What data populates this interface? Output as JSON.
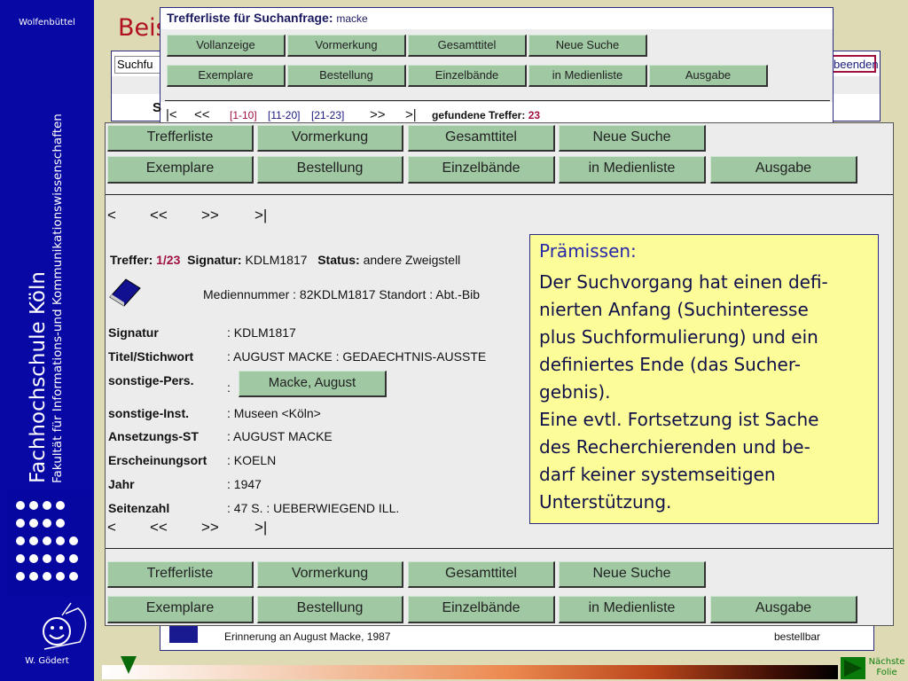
{
  "sidebar": {
    "top_label": "Wolfenbüttel",
    "institution": "Fachhochschule Köln",
    "faculty": "Fakultät für Informations-und Kommunikationswissenschaften",
    "author": "W. Gödert"
  },
  "slide": {
    "title": "Beis",
    "next_label_1": "Nächste",
    "next_label_2": "Folie"
  },
  "back_window": {
    "search_field": "Suchfu",
    "end_button": "beenden"
  },
  "result_window": {
    "title": "Trefferliste für Suchanfrage:",
    "query": "macke",
    "row1": [
      "Vollanzeige",
      "Vormerkung",
      "Gesamttitel",
      "Neue Suche"
    ],
    "row2": [
      "Exemplare",
      "Bestellung",
      "Einzelbände",
      "in Medienliste",
      "Ausgabe"
    ],
    "nav": [
      "|<",
      "<<",
      "[1-10]",
      "[11-20]",
      "[21-23]",
      ">>",
      ">|"
    ],
    "found_label": "gefundene Treffer:",
    "found_count": "23",
    "s": "S"
  },
  "detail": {
    "row1": [
      "Trefferliste",
      "Vormerkung",
      "Gesamttitel",
      "Neue Suche"
    ],
    "row2": [
      "Exemplare",
      "Bestellung",
      "Einzelbände",
      "in Medienliste",
      "Ausgabe"
    ],
    "nav": [
      "<",
      "<<",
      ">>",
      ">|"
    ],
    "hit_label": "Treffer:",
    "hit_value": "1/23",
    "sig_label": "Signatur:",
    "sig_value": "KDLM1817",
    "status_label": "Status:",
    "status_value": "andere Zweigstell",
    "media_line": "Mediennummer : 82KDLM1817 Standort : Abt.-Bib",
    "fields": [
      {
        "label": "Signatur",
        "value": ": KDLM1817"
      },
      {
        "label": "Titel/Stichwort",
        "value": ": AUGUST MACKE : GEDAECHTNIS-AUSSTE"
      },
      {
        "label": "sonstige-Pers.",
        "value": ":",
        "button": "Macke, August"
      },
      {
        "label": "sonstige-Inst.",
        "value": ": Museen <Köln>"
      },
      {
        "label": "Ansetzungs-ST",
        "value": ": AUGUST MACKE"
      },
      {
        "label": "Erscheinungsort",
        "value": ": KOELN"
      },
      {
        "label": "Jahr",
        "value": ": 1947"
      },
      {
        "label": "Seitenzahl",
        "value": ": 47 S. : UEBERWIEGEND ILL."
      }
    ]
  },
  "bottom_window": {
    "item": "Erinnerung an August Macke,  1987",
    "status": "bestellbar"
  },
  "note": {
    "heading": "Prämissen:",
    "text": "Der Suchvorgang hat einen defi-\nnierten Anfang (Suchinteresse\nplus Suchformulierung) und ein\ndefiniertes Ende (das Sucher-\ngebnis).\nEine evtl. Fortsetzung ist Sache\ndes Recherchierenden und be-\ndarf keiner systemseitigen\nUnterstützung."
  },
  "colors": {
    "sidebar": "#0808a4",
    "slide_bg": "#dedab4",
    "button": "#9fc8a3",
    "note_bg": "#fcfc98",
    "accent_red": "#a01040"
  }
}
